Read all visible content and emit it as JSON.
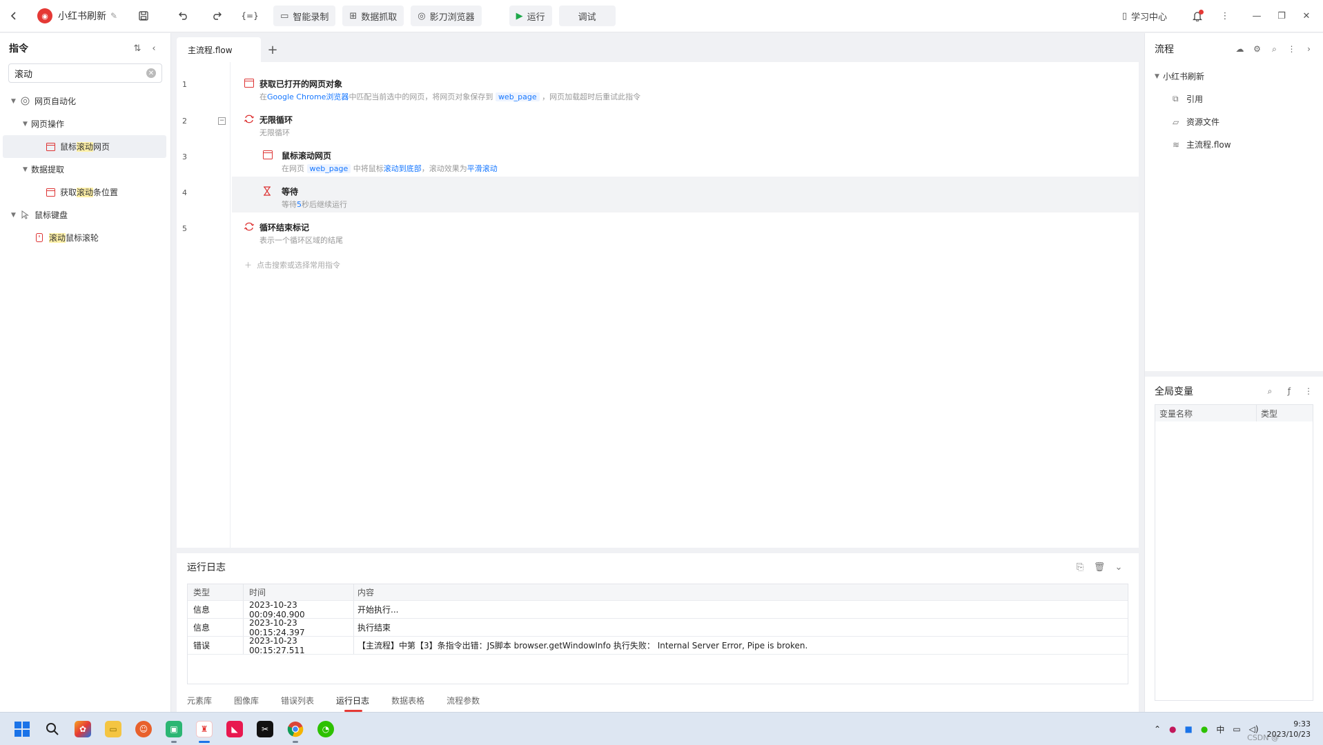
{
  "topbar": {
    "project_name": "小红书刷新",
    "buttons": {
      "record": "智能录制",
      "scrape": "数据抓取",
      "browser": "影刀浏览器",
      "run": "运行",
      "debug": "调试"
    },
    "learn": "学习中心"
  },
  "left": {
    "title": "指令",
    "search_value": "滚动",
    "tree": [
      {
        "pre": "",
        "hl": "",
        "post": "网页自动化"
      },
      {
        "pre": "",
        "hl": "",
        "post": "网页操作"
      },
      {
        "pre": "鼠标",
        "hl": "滚动",
        "post": "网页"
      },
      {
        "pre": "",
        "hl": "",
        "post": "数据提取"
      },
      {
        "pre": "获取",
        "hl": "滚动",
        "post": "条位置"
      },
      {
        "pre": "",
        "hl": "",
        "post": "鼠标键盘"
      },
      {
        "pre": "",
        "hl": "滚动",
        "post": "鼠标滚轮"
      }
    ]
  },
  "editor": {
    "tab": "主流程.flow",
    "line_numbers": [
      "1",
      "2",
      "3",
      "4",
      "5"
    ],
    "rows": [
      {
        "title": "获取已打开的网页对象",
        "d1": "在",
        "link1": "Google Chrome浏览器",
        "d2": "中匹配当前选中的网页，将网页对象保存到",
        "var": "web_page",
        "d3": "，网页加载超时后重试此指令"
      },
      {
        "title": "无限循环",
        "desc": "无限循环"
      },
      {
        "title": "鼠标滚动网页",
        "d1": "在网页",
        "var": "web_page",
        "d2": "中将鼠标",
        "link1": "滚动到底部",
        "d3": "，滚动效果为",
        "link2": "平滑滚动"
      },
      {
        "title": "等待",
        "d1": "等待",
        "num": "5",
        "d2": "秒后继续运行"
      },
      {
        "title": "循环结束标记",
        "desc": "表示一个循环区域的结尾"
      }
    ],
    "add_hint": "点击搜索或选择常用指令"
  },
  "log": {
    "title": "运行日志",
    "headers": [
      "类型",
      "时间",
      "内容"
    ],
    "rows": [
      {
        "type": "信息",
        "time": "2023-10-23 00:09:40.900",
        "content": "开始执行..."
      },
      {
        "type": "信息",
        "time": "2023-10-23 00:15:24.397",
        "content": "执行结束"
      },
      {
        "type": "错误",
        "time": "2023-10-23 00:15:27.511",
        "content": "【主流程】中第【3】条指令出错：JS脚本 browser.getWindowInfo 执行失败： Internal Server Error, Pipe is broken."
      }
    ],
    "tabs": [
      "元素库",
      "图像库",
      "错误列表",
      "运行日志",
      "数据表格",
      "流程参数"
    ],
    "active_tab": "运行日志"
  },
  "right": {
    "title": "流程",
    "root": "小红书刷新",
    "items": [
      "引用",
      "资源文件",
      "主流程.flow"
    ],
    "globals_title": "全局变量",
    "globals_headers": [
      "变量名称",
      "类型"
    ]
  },
  "taskbar": {
    "time": "9:33",
    "date": "2023/10/23",
    "ime": "中",
    "watermark": "CSDN @"
  },
  "colors": {
    "accent": "#1677ff",
    "brand": "#e53935",
    "highlight": "#fff1a8",
    "run_green": "#1ea84a"
  }
}
